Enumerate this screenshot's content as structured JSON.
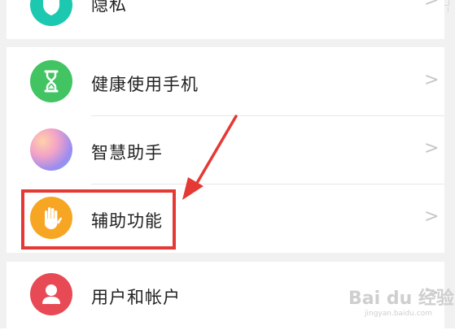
{
  "colors": {
    "privacy": "#1cc8b0",
    "health": "#43c463",
    "assistant_start": "#f3a3c7",
    "accessibility": "#f7a623",
    "account": "#e84a55",
    "highlight": "#e53935"
  },
  "settings": {
    "items": [
      {
        "label": "隐私",
        "icon": "privacy-icon",
        "chevron": ">"
      },
      {
        "label": "健康使用手机",
        "icon": "hourglass-icon",
        "chevron": ">"
      },
      {
        "label": "智慧助手",
        "icon": "smart-assistant-icon",
        "chevron": ">"
      },
      {
        "label": "辅助功能",
        "icon": "hand-icon",
        "chevron": ">"
      },
      {
        "label": "用户和帐户",
        "icon": "user-icon",
        "chevron": ">"
      }
    ]
  },
  "watermark": {
    "brand": "Bai du 经验",
    "url": "jingyan.baidu.com"
  }
}
